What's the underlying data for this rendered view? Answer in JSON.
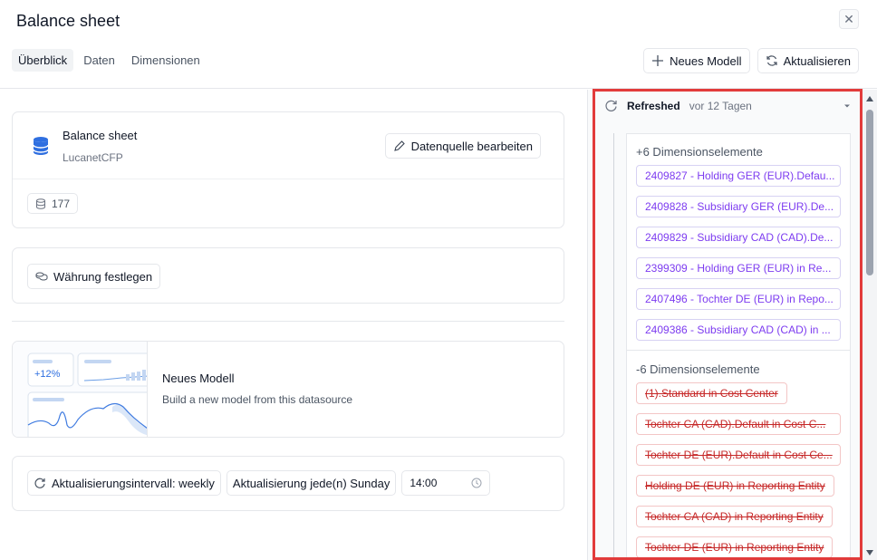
{
  "header": {
    "title": "Balance sheet",
    "tabs": [
      "Überblick",
      "Daten",
      "Dimensionen"
    ],
    "new_model_label": "Neues Modell",
    "refresh_label": "Aktualisieren"
  },
  "datasource": {
    "name": "Balance sheet",
    "source": "LucanetCFP",
    "edit_label": "Datenquelle bearbeiten",
    "count": "177"
  },
  "currency": {
    "label": "Währung festlegen"
  },
  "model": {
    "thumb_percent": "+12%",
    "title": "Neues Modell",
    "description": "Build a new model from this datasource"
  },
  "schedule": {
    "interval_label": "Aktualisierungsintervall: weekly",
    "day_label": "Aktualisierung jede(n) Sunday",
    "time": "14:00"
  },
  "refresh_panel": {
    "status": "Refreshed",
    "time_ago": "vor 12 Tagen",
    "added_title": "+6 Dimensionselemente",
    "added": [
      "2409827 - Holding GER (EUR).Defau...",
      "2409828 - Subsidiary GER (EUR).De...",
      "2409829 - Subsidiary CAD (CAD).De...",
      "2399309 - Holding GER (EUR) in Re...",
      "2407496 - Tochter DE (EUR) in Repo...",
      "2409386 - Subsidiary CAD (CAD) in ..."
    ],
    "removed_title": "-6 Dimensionselemente",
    "removed": [
      "(1).Standard in Cost Center",
      "Tochter CA (CAD).Default in Cost C...",
      "Tochter DE (EUR).Default in Cost Ce...",
      "Holding DE (EUR) in Reporting Entity",
      "Tochter CA (CAD) in Reporting Entity",
      "Tochter DE (EUR) in Reporting Entity"
    ]
  },
  "colors": {
    "accent_purple": "#7d3cf0",
    "removed_red": "#c62828",
    "highlight_red": "#e23b3b",
    "db_icon_blue": "#2f6fe0"
  }
}
